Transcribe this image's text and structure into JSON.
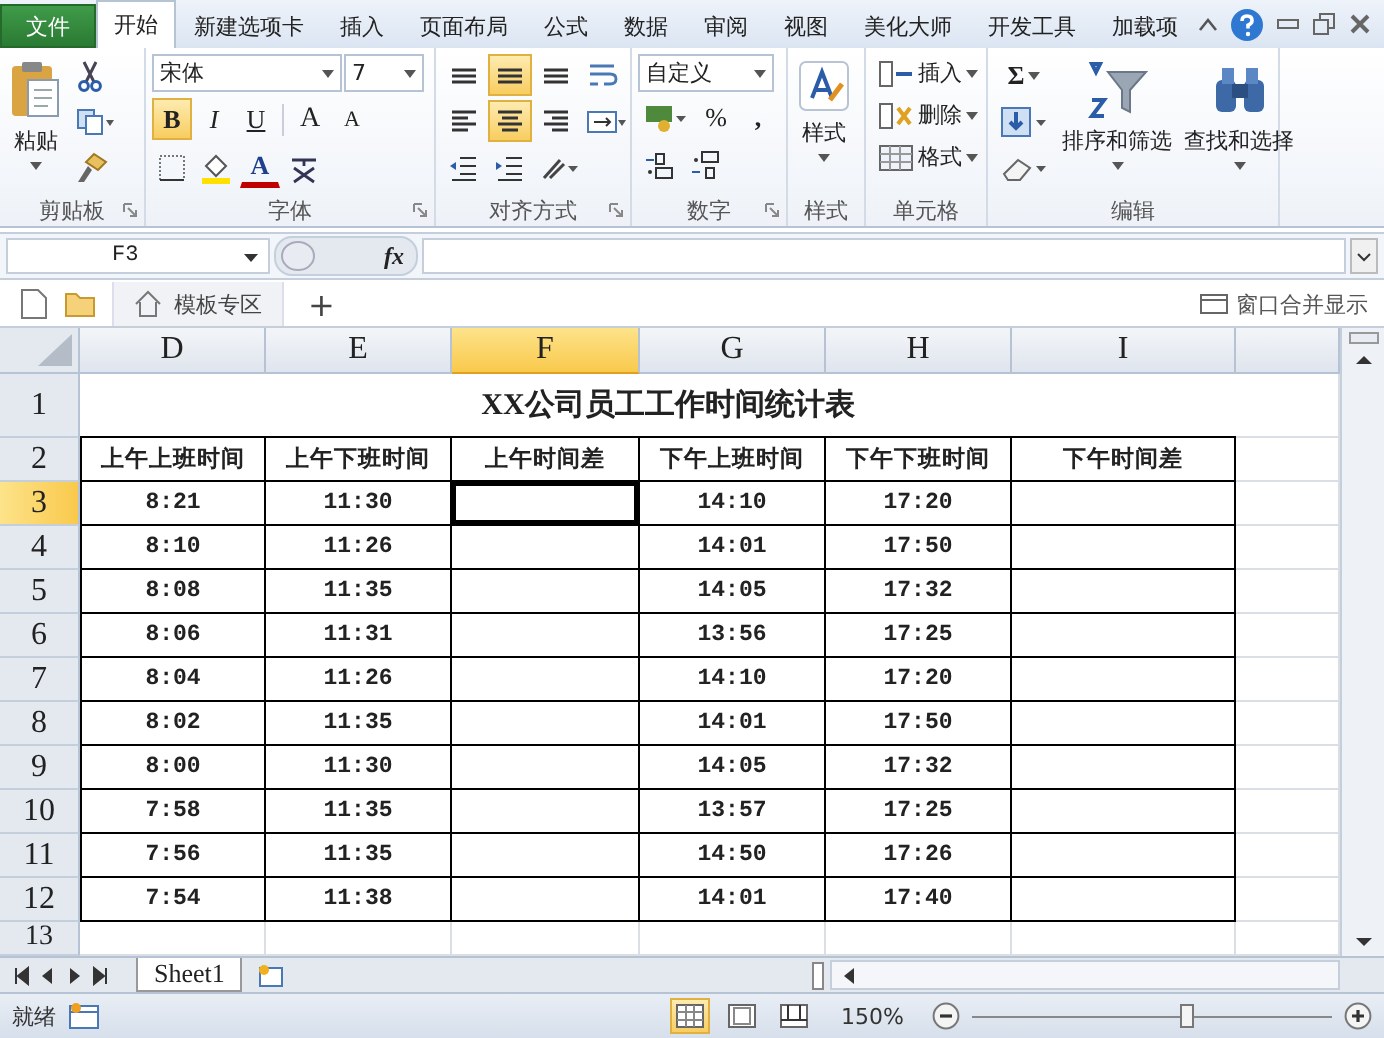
{
  "menu_tabs": [
    {
      "label": "文件",
      "kind": "file",
      "selected": false
    },
    {
      "label": "开始",
      "kind": "tab",
      "selected": true
    },
    {
      "label": "新建选项卡",
      "kind": "tab",
      "selected": false
    },
    {
      "label": "插入",
      "kind": "tab",
      "selected": false
    },
    {
      "label": "页面布局",
      "kind": "tab",
      "selected": false
    },
    {
      "label": "公式",
      "kind": "tab",
      "selected": false
    },
    {
      "label": "数据",
      "kind": "tab",
      "selected": false
    },
    {
      "label": "审阅",
      "kind": "tab",
      "selected": false
    },
    {
      "label": "视图",
      "kind": "tab",
      "selected": false
    },
    {
      "label": "美化大师",
      "kind": "tab",
      "selected": false
    },
    {
      "label": "开发工具",
      "kind": "tab",
      "selected": false
    },
    {
      "label": "加载项",
      "kind": "tab",
      "selected": false
    }
  ],
  "ribbon": [
    {
      "kind": "clipboard",
      "label": "剪贴板",
      "launcher": true,
      "paste": "粘贴"
    },
    {
      "kind": "font",
      "label": "字体",
      "launcher": true,
      "font_name": "宋体",
      "font_size": "7",
      "bold_label": "B",
      "bold": true,
      "italic_label": "I",
      "italic": false,
      "underline_label": "U",
      "underline": false,
      "grow_label": "A",
      "shrink_label": "A",
      "font_color_label": "A"
    },
    {
      "kind": "alignment",
      "label": "对齐方式",
      "launcher": true,
      "top_align": false,
      "middle_align": true,
      "bottom_align": false,
      "left_align": false,
      "center_align": true,
      "right_align": false
    },
    {
      "kind": "number",
      "label": "数字",
      "launcher": true,
      "format": "自定义",
      "percent": "%",
      "comma": ","
    },
    {
      "kind": "styles",
      "label": "样式",
      "launcher": false,
      "button": "样式"
    },
    {
      "kind": "cells",
      "label": "单元格",
      "launcher": false,
      "insert": "插入",
      "delete": "删除",
      "format": "格式"
    },
    {
      "kind": "editing",
      "label": "编辑",
      "launcher": false,
      "sum": "Σ",
      "sort": "排序和筛选",
      "find": "查找和选择"
    }
  ],
  "formula_bar": {
    "name_box": "F3",
    "function_label": "fx"
  },
  "doc_tabs": {
    "template_tab": "模板专区",
    "add": "+",
    "merge_windows": "窗口合并显示"
  },
  "columns": [
    {
      "label": "D",
      "selected": false
    },
    {
      "label": "E",
      "selected": false
    },
    {
      "label": "F",
      "selected": true
    },
    {
      "label": "G",
      "selected": false
    },
    {
      "label": "H",
      "selected": false
    },
    {
      "label": "I",
      "selected": false
    }
  ],
  "title_row": {
    "row": "1",
    "title": "XX公司员工工作时间统计表"
  },
  "header_row": {
    "row": "2",
    "headers": [
      "上午上班时间",
      "上午下班时间",
      "上午时间差",
      "下午上班时间",
      "下午下班时间",
      "下午时间差"
    ]
  },
  "rows": [
    {
      "row": "3",
      "active": true,
      "cells": [
        "8:21",
        "11:30",
        "",
        "14:10",
        "17:20",
        ""
      ]
    },
    {
      "row": "4",
      "active": false,
      "cells": [
        "8:10",
        "11:26",
        "",
        "14:01",
        "17:50",
        ""
      ]
    },
    {
      "row": "5",
      "active": false,
      "cells": [
        "8:08",
        "11:35",
        "",
        "14:05",
        "17:32",
        ""
      ]
    },
    {
      "row": "6",
      "active": false,
      "cells": [
        "8:06",
        "11:31",
        "",
        "13:56",
        "17:25",
        ""
      ]
    },
    {
      "row": "7",
      "active": false,
      "cells": [
        "8:04",
        "11:26",
        "",
        "14:10",
        "17:20",
        ""
      ]
    },
    {
      "row": "8",
      "active": false,
      "cells": [
        "8:02",
        "11:35",
        "",
        "14:01",
        "17:50",
        ""
      ]
    },
    {
      "row": "9",
      "active": false,
      "cells": [
        "8:00",
        "11:30",
        "",
        "14:05",
        "17:32",
        ""
      ]
    },
    {
      "row": "10",
      "active": false,
      "cells": [
        "7:58",
        "11:35",
        "",
        "13:57",
        "17:25",
        ""
      ]
    },
    {
      "row": "11",
      "active": false,
      "cells": [
        "7:56",
        "11:35",
        "",
        "14:50",
        "17:26",
        ""
      ]
    },
    {
      "row": "12",
      "active": false,
      "cells": [
        "7:54",
        "11:38",
        "",
        "14:01",
        "17:40",
        ""
      ]
    }
  ],
  "empty_row": {
    "row": "13"
  },
  "sheet_tabs": [
    {
      "label": "Sheet1",
      "selected": true
    }
  ],
  "status_bar": {
    "status": "就绪",
    "views": [
      {
        "kind": "normal",
        "selected": true
      },
      {
        "kind": "layout",
        "selected": false
      },
      {
        "kind": "break",
        "selected": false
      }
    ],
    "zoom": "150%",
    "zoom_slider": {
      "level": 0.6
    }
  }
}
